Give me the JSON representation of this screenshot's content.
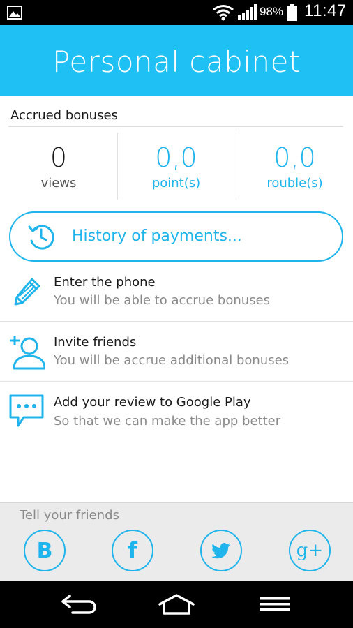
{
  "status_bar": {
    "battery_percent": "98%",
    "time": "11:47",
    "icons": [
      "gallery-notification-icon",
      "wifi-icon",
      "signal-icon",
      "battery-icon"
    ]
  },
  "header": {
    "title": "Personal cabinet",
    "color": "#1fc1f4"
  },
  "bonuses": {
    "title": "Accrued bonuses",
    "items": [
      {
        "value": "0",
        "label": "views"
      },
      {
        "value": "0,0",
        "label": "point(s)"
      },
      {
        "value": "0,0",
        "label": "rouble(s)"
      }
    ]
  },
  "history": {
    "label": "History of payments...",
    "icon": "history-clock-icon"
  },
  "list": [
    {
      "title": "Enter the phone",
      "subtitle": "You will be able to accrue bonuses",
      "icon": "pencil-icon"
    },
    {
      "title": "Invite friends",
      "subtitle": "You will be accrue additional bonuses",
      "icon": "add-person-icon"
    },
    {
      "title": "Add your review to Google Play",
      "subtitle": "So that we can make the app better",
      "icon": "chat-bubble-icon"
    }
  ],
  "share": {
    "title": "Tell your friends",
    "networks": [
      {
        "name": "vk",
        "glyph": "B"
      },
      {
        "name": "facebook",
        "glyph": "f"
      },
      {
        "name": "twitter",
        "glyph": ""
      },
      {
        "name": "google-plus",
        "glyph": "g+"
      }
    ]
  },
  "nav": [
    "back-icon",
    "home-icon",
    "menu-icon"
  ],
  "accent_color": "#1fb5ec"
}
